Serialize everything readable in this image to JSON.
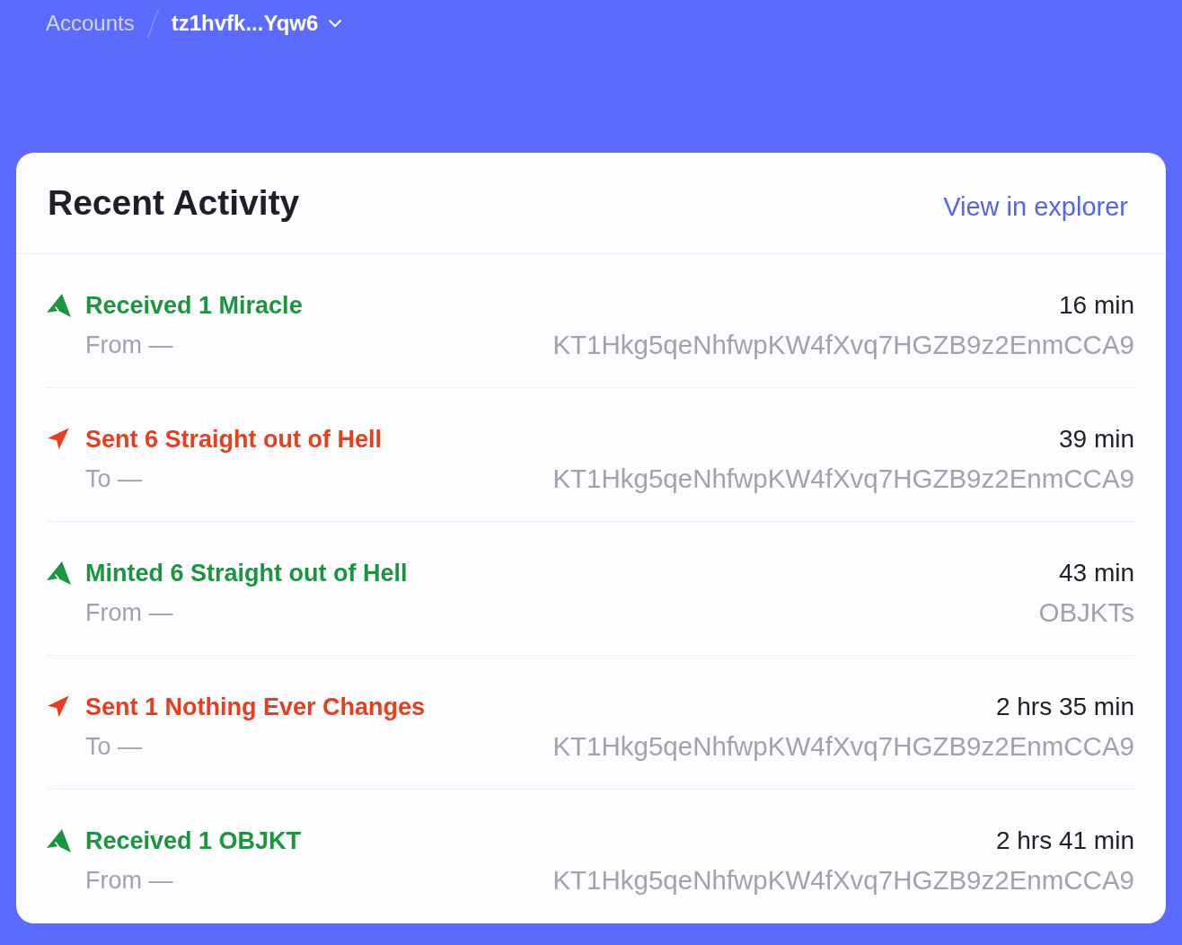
{
  "breadcrumb": {
    "parent": "Accounts",
    "current": "tz1hvfk...Yqw6"
  },
  "card": {
    "title": "Recent Activity",
    "link": "View in explorer"
  },
  "activities": [
    {
      "kind": "received",
      "title": "Received 1 Miracle",
      "party_label": "From —",
      "time": "16 min",
      "party": "KT1Hkg5qeNhfwpKW4fXvq7HGZB9z2EnmCCA9"
    },
    {
      "kind": "sent",
      "title": "Sent 6 Straight out of Hell",
      "party_label": "To —",
      "time": "39 min",
      "party": "KT1Hkg5qeNhfwpKW4fXvq7HGZB9z2EnmCCA9"
    },
    {
      "kind": "minted",
      "title": "Minted 6 Straight out of Hell",
      "party_label": "From —",
      "time": "43 min",
      "party": "OBJKTs"
    },
    {
      "kind": "sent",
      "title": "Sent 1 Nothing Ever Changes",
      "party_label": "To —",
      "time": "2 hrs 35 min",
      "party": "KT1Hkg5qeNhfwpKW4fXvq7HGZB9z2EnmCCA9"
    },
    {
      "kind": "received",
      "title": "Received 1 OBJKT",
      "party_label": "From —",
      "time": "2 hrs 41 min",
      "party": "KT1Hkg5qeNhfwpKW4fXvq7HGZB9z2EnmCCA9"
    }
  ]
}
